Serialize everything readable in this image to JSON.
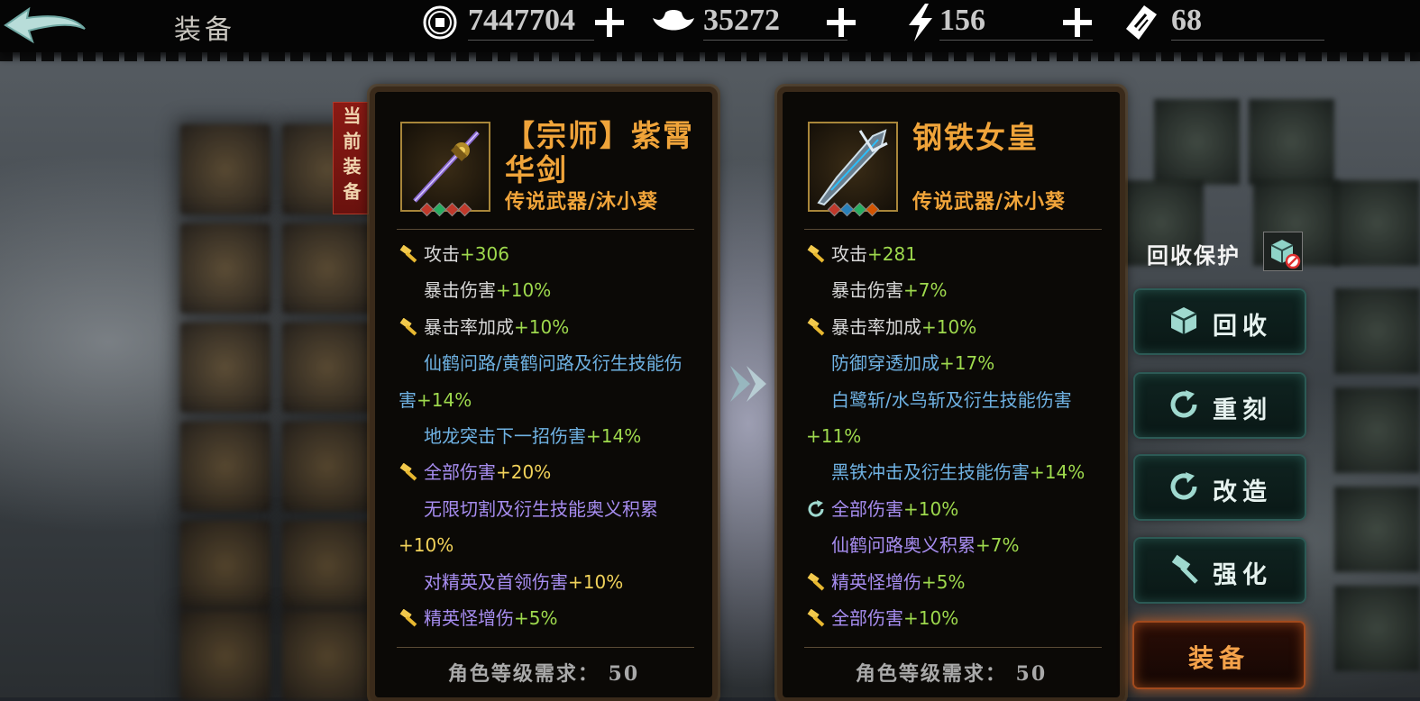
{
  "header": {
    "title": "装备",
    "resources": [
      {
        "icon": "copper-coin-icon",
        "value": "7447704",
        "addable": true
      },
      {
        "icon": "silver-ingot-icon",
        "value": "35272",
        "addable": true
      },
      {
        "icon": "lightning-icon",
        "value": "156",
        "addable": true
      },
      {
        "icon": "ticket-icon",
        "value": "68",
        "addable": false
      }
    ]
  },
  "current_tag": "当前装备",
  "current_item": {
    "name": "【宗师】紫霄华剑",
    "subtitle": "传说武器/沐小葵",
    "gem_colors": [
      "#c0392b",
      "#27ae60",
      "#c0392b",
      "#c0392b"
    ],
    "stats": [
      {
        "text": "攻击",
        "bonus": "+306",
        "color": "white",
        "bonus_color": "green",
        "icon": "hammer"
      },
      {
        "text": "暴击伤害",
        "bonus": "+10%",
        "color": "white",
        "bonus_color": "green",
        "icon": ""
      },
      {
        "text": "暴击率加成",
        "bonus": "+10%",
        "color": "white",
        "bonus_color": "green",
        "icon": "hammer"
      },
      {
        "text": "仙鹤问路/黄鹤问路及衍生技能伤害",
        "bonus": "+14%",
        "color": "blue",
        "bonus_color": "green",
        "icon": "",
        "wrap": true
      },
      {
        "text": "地龙突击下一招伤害",
        "bonus": "+14%",
        "color": "blue",
        "bonus_color": "green",
        "icon": ""
      },
      {
        "text": "全部伤害",
        "bonus": "+20%",
        "color": "purple",
        "bonus_color": "gold",
        "icon": "hammer"
      },
      {
        "text": "无限切割及衍生技能奥义积累",
        "bonus": "+10%",
        "color": "purple",
        "bonus_color": "gold",
        "icon": "",
        "wrap": true
      },
      {
        "text": "对精英及首领伤害",
        "bonus": "+10%",
        "color": "purple",
        "bonus_color": "gold",
        "icon": ""
      },
      {
        "text": "精英怪增伤",
        "bonus": "+5%",
        "color": "purple",
        "bonus_color": "green",
        "icon": "hammer"
      }
    ],
    "requirement": "角色等级需求：  50"
  },
  "compare_item": {
    "name": "钢铁女皇",
    "subtitle": "传说武器/沐小葵",
    "gem_colors": [
      "#c0392b",
      "#2980b9",
      "#27ae60",
      "#d35400"
    ],
    "stats": [
      {
        "text": "攻击",
        "bonus": "+281",
        "color": "white",
        "bonus_color": "green",
        "icon": "hammer"
      },
      {
        "text": "暴击伤害",
        "bonus": "+7%",
        "color": "white",
        "bonus_color": "green",
        "icon": ""
      },
      {
        "text": "暴击率加成",
        "bonus": "+10%",
        "color": "white",
        "bonus_color": "green",
        "icon": "hammer"
      },
      {
        "text": "防御穿透加成",
        "bonus": "+17%",
        "color": "blue",
        "bonus_color": "green",
        "icon": ""
      },
      {
        "text": "白鹭斩/水鸟斩及衍生技能伤害",
        "bonus": "+11%",
        "color": "blue",
        "bonus_color": "green",
        "icon": "",
        "wrap": true
      },
      {
        "text": "黑铁冲击及衍生技能伤害",
        "bonus": "+14%",
        "color": "blue",
        "bonus_color": "green",
        "icon": ""
      },
      {
        "text": "全部伤害",
        "bonus": "+10%",
        "color": "purple",
        "bonus_color": "green",
        "icon": "refresh"
      },
      {
        "text": "仙鹤问路奥义积累",
        "bonus": "+7%",
        "color": "purple",
        "bonus_color": "green",
        "icon": ""
      },
      {
        "text": "精英怪增伤",
        "bonus": "+5%",
        "color": "purple",
        "bonus_color": "green",
        "icon": "hammer"
      },
      {
        "text": "全部伤害",
        "bonus": "+10%",
        "color": "purple",
        "bonus_color": "green",
        "icon": "hammer"
      }
    ],
    "requirement": "角色等级需求：  50"
  },
  "actions": {
    "recycle_protect_label": "回收保护",
    "recycle_label": "回收",
    "reengrave_label": "重刻",
    "modify_label": "改造",
    "enhance_label": "强化",
    "equip_label": "装备"
  },
  "colors": {
    "name_orange": "#f0a43a",
    "stat_white": "#d8d8d8",
    "stat_green": "#9ed94d",
    "stat_blue": "#6fb2e3",
    "stat_purple": "#a78df0",
    "stat_gold": "#f1d25a",
    "equip_glow": "#e26622"
  }
}
